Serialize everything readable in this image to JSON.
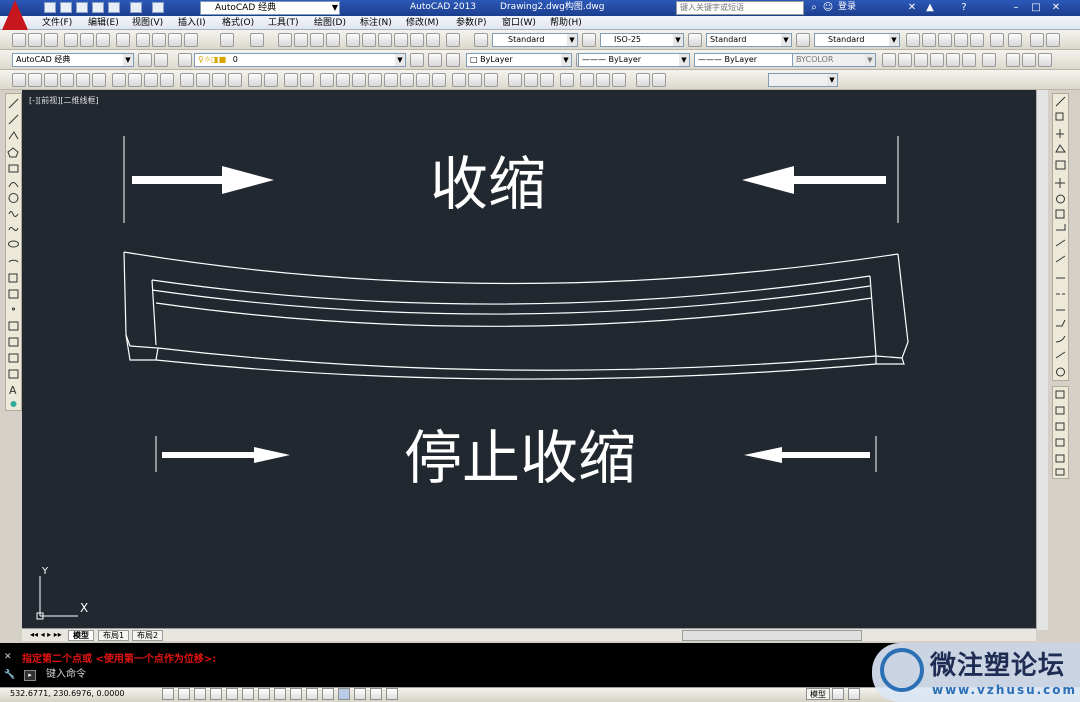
{
  "titlebar": {
    "workspace": "AutoCAD 经典",
    "app_version": "AutoCAD 2013",
    "document": "Drawing2.dwg构图.dwg",
    "search_placeholder": "键入关键字或短语",
    "login": "登录"
  },
  "menu": [
    "文件(F)",
    "编辑(E)",
    "视图(V)",
    "插入(I)",
    "格式(O)",
    "工具(T)",
    "绘图(D)",
    "标注(N)",
    "修改(M)",
    "参数(P)",
    "窗口(W)",
    "帮助(H)"
  ],
  "toolbar1": {
    "text_style": "Standard",
    "dim_style": "ISO-25",
    "table_style": "Standard",
    "mleader_style": "Standard"
  },
  "toolbar2": {
    "workspace": "AutoCAD 经典",
    "layer": "0",
    "color": "ByLayer",
    "linetype": "ByLayer",
    "lineweight": "ByLayer",
    "plotstyle": "BYCOLOR"
  },
  "viewport": {
    "label": "[-][前视][二维线框]",
    "top_text": "收缩",
    "bottom_text": "停止收缩",
    "ucs_y": "Y",
    "ucs_x": "X"
  },
  "layout_tabs": [
    "模型",
    "布局1",
    "布局2"
  ],
  "command": {
    "history": "指定第二个点或 <使用第一个点作为位移>:",
    "input_placeholder": "键入命令"
  },
  "status": {
    "coords": "532.6771, 230.6976, 0.0000",
    "model": "模型"
  },
  "watermark": {
    "text": "微注塑论坛",
    "url": "www.vzhusu.com"
  },
  "colors": {
    "canvas_bg": "#212830",
    "cad_white": "#ffffff",
    "command_red": "#e21313",
    "title_blue": "#1c3f8e"
  }
}
